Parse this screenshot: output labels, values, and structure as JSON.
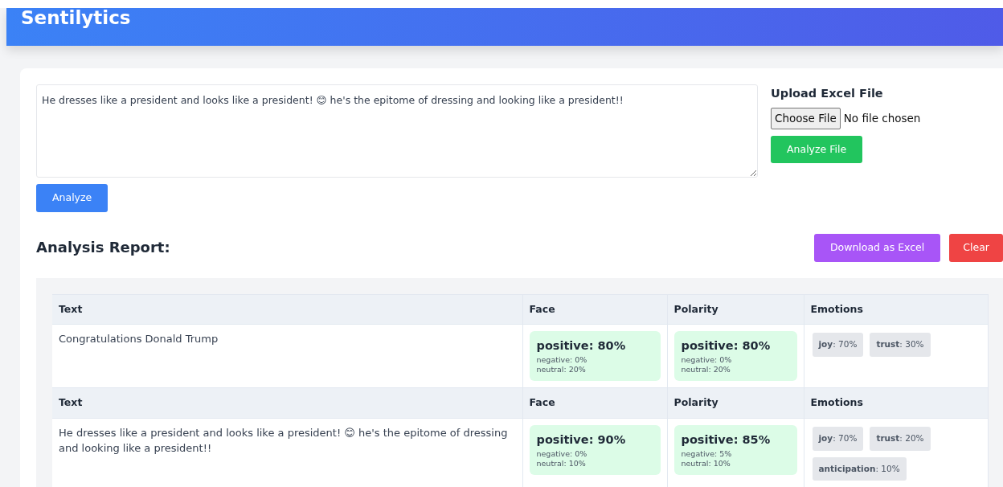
{
  "header": {
    "title": "Sentilytics"
  },
  "input": {
    "value": "He dresses like a president and looks like a president! 😊 he's the epitome of dressing and looking like a president!!"
  },
  "analyze_button": "Analyze",
  "upload": {
    "heading": "Upload Excel File",
    "choose_button": "Choose File",
    "file_status": "No file chosen",
    "analyze_button": "Analyze File"
  },
  "report": {
    "title": "Analysis Report:",
    "download_button": "Download as Excel",
    "clear_button": "Clear"
  },
  "results": [
    {
      "columns": [
        "Text",
        "Face",
        "Polarity",
        "Emotions"
      ],
      "text": "Congratulations Donald Trump",
      "face": {
        "color": "#dcfce7",
        "main": "positive: 80%",
        "negative": "negative: 0%",
        "neutral": "neutral: 20%"
      },
      "polarity": {
        "color": "#dcfce7",
        "main": "positive: 80%",
        "negative": "negative: 0%",
        "neutral": "neutral: 20%"
      },
      "emotions": [
        "**joy**: 70%",
        "**trust**: 30%"
      ]
    },
    {
      "columns": [
        "Text",
        "Face",
        "Polarity",
        "Emotions"
      ],
      "text": "He dresses like a president and looks like a president! 😊 he's the epitome of dressing and looking like a president!!",
      "face": {
        "color": "#dcfce7",
        "main": "positive: 90%",
        "negative": "negative: 0%",
        "neutral": "neutral: 10%"
      },
      "polarity": {
        "color": "#dcfce7",
        "main": "positive: 85%",
        "negative": "negative: 5%",
        "neutral": "neutral: 10%"
      },
      "emotions": [
        "**joy**: 70%",
        "**trust**: 20%",
        "**anticipation**: 10%"
      ]
    }
  ]
}
